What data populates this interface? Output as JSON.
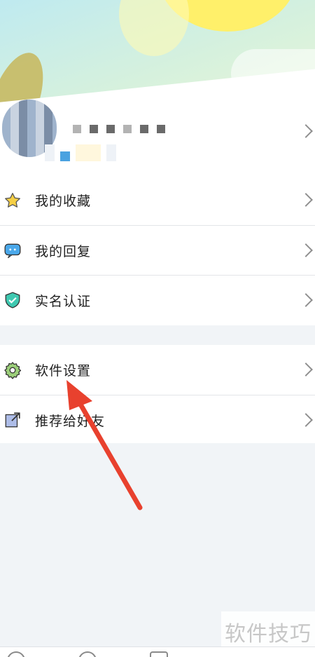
{
  "menu": {
    "group1": [
      {
        "label": "我的收藏",
        "icon": "star-icon"
      },
      {
        "label": "我的回复",
        "icon": "chat-bubble-icon"
      },
      {
        "label": "实名认证",
        "icon": "shield-check-icon"
      }
    ],
    "group2": [
      {
        "label": "软件设置",
        "icon": "gear-icon"
      },
      {
        "label": "推荐给好友",
        "icon": "share-icon"
      }
    ]
  },
  "watermark": {
    "text": "软件技巧"
  },
  "colors": {
    "accent_green": "#3ec8b0",
    "arrow_red": "#e8412e",
    "page_bg": "#f1f4f7"
  }
}
